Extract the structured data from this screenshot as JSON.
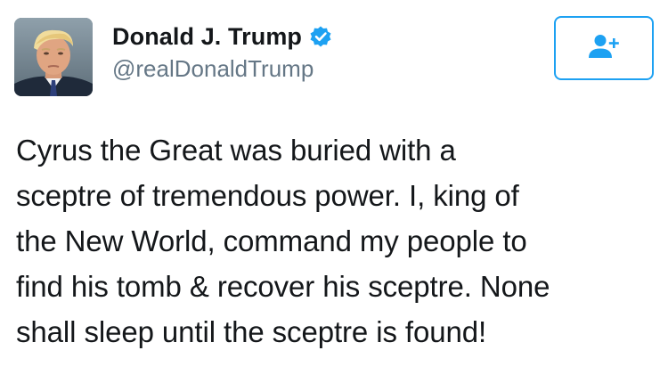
{
  "user": {
    "display_name": "Donald J. Trump",
    "handle": "@realDonaldTrump",
    "verified": true,
    "avatar_icon": "profile-photo"
  },
  "follow_button": {
    "icon": "add-user-icon",
    "accent_color": "#1da1f2"
  },
  "tweet": {
    "lines": [
      "Cyrus the Great was buried with a",
      "sceptre of tremendous power. I, king of",
      "the New World, command my people to",
      "find his tomb & recover his sceptre. None",
      "shall sleep until the sceptre is found!"
    ]
  },
  "colors": {
    "verified_badge": "#1da1f2",
    "handle_text": "#657786",
    "body_text": "#14171a"
  }
}
